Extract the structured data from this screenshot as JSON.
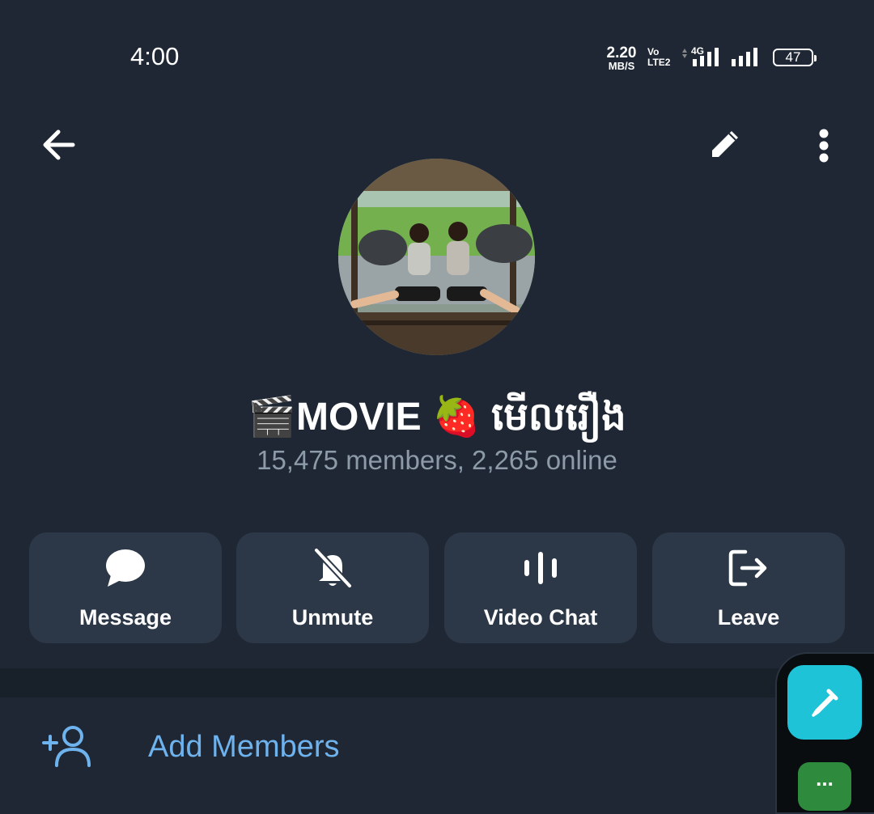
{
  "status_bar": {
    "time": "4:00",
    "net_speed_value": "2.20",
    "net_speed_unit": "MB/S",
    "volte_line1": "Vo",
    "volte_line2": "LTE2",
    "network_type": "4G",
    "battery": "47"
  },
  "header": {
    "back_icon": "arrow-left-icon",
    "edit_icon": "pencil-icon",
    "menu_icon": "more-vertical-icon"
  },
  "profile": {
    "title": "🎬MOVIE 🍓 មើលរឿង",
    "subtitle": "15,475 members, 2,265 online"
  },
  "actions": [
    {
      "label": "Message",
      "icon": "message-bubble-icon"
    },
    {
      "label": "Unmute",
      "icon": "bell-off-icon"
    },
    {
      "label": "Video Chat",
      "icon": "voice-bars-icon"
    },
    {
      "label": "Leave",
      "icon": "leave-icon"
    }
  ],
  "list": {
    "add_members_label": "Add Members",
    "add_members_icon": "add-user-icon"
  },
  "floating": {
    "pen_icon": "eyedropper-icon",
    "more_label": "..."
  },
  "colors": {
    "background": "#1e2733",
    "button_bg": "#2c3847",
    "accent_link": "#6fb3ee",
    "subtitle": "#8d9aa8",
    "fab": "#1ec3d7"
  }
}
